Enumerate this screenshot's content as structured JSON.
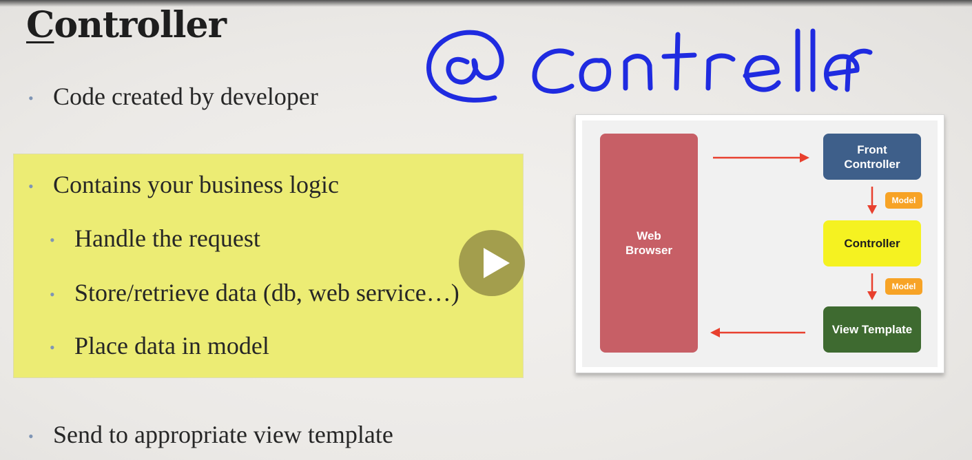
{
  "slide": {
    "title_first_letter": "C",
    "title_rest": "ontroller",
    "handwritten_annotation": "@controller",
    "bullets": {
      "code_created": "Code created by developer",
      "business_logic": "Contains your business logic",
      "handle_request": "Handle the request",
      "store_retrieve": "Store/retrieve data (db, web service…)",
      "place_data": "Place data in model",
      "send_view": "Send to appropriate view template"
    }
  },
  "diagram": {
    "web_browser": "Web Browser",
    "front_controller": "Front Controller",
    "controller": "Controller",
    "view_template": "View Template",
    "model_badge_1": "Model",
    "model_badge_2": "Model"
  },
  "player": {
    "play_icon": "play-icon"
  },
  "colors": {
    "highlight": "#ecec74",
    "web_browser": "#c75f66",
    "front_controller": "#3e5f8a",
    "controller": "#f5f221",
    "view_template": "#3e6a30",
    "model_badge": "#f7a326",
    "arrow": "#e8402e",
    "handwriting": "#1f2be0"
  }
}
